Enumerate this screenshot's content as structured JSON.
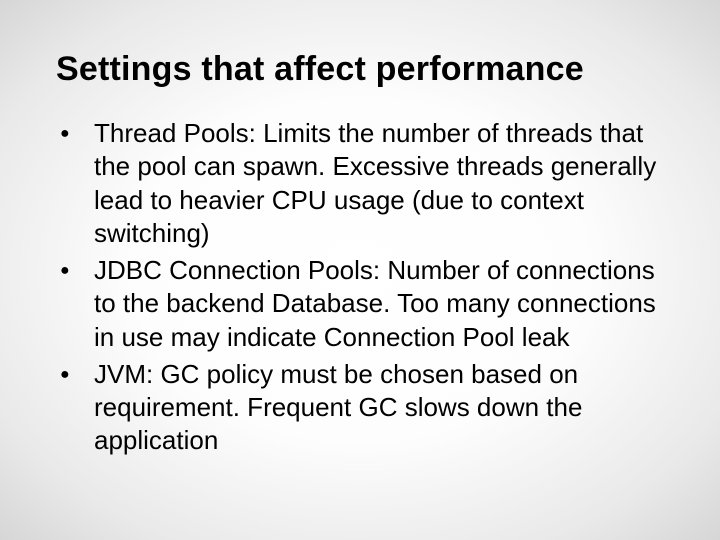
{
  "title": "Settings that affect performance",
  "bullets": [
    "Thread Pools: Limits the number of threads that the pool can spawn. Excessive threads generally lead to heavier CPU usage (due to context switching)",
    "JDBC Connection Pools: Number of connections to the backend Database. Too many connections in use may indicate Connection Pool leak",
    "JVM: GC policy must be chosen based on requirement. Frequent GC slows down the application"
  ]
}
